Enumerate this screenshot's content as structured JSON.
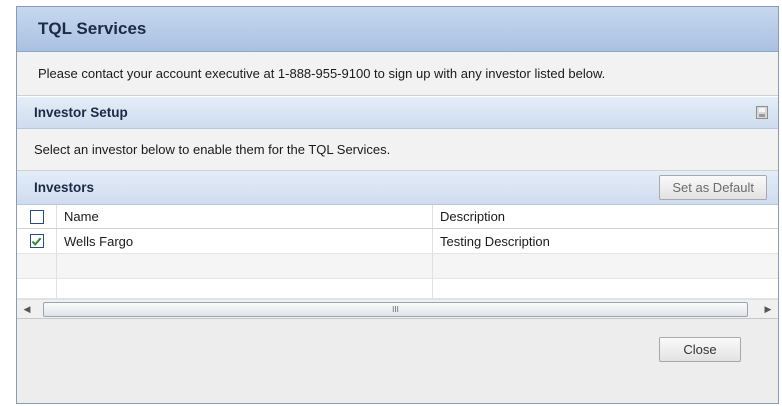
{
  "dialog": {
    "title": "TQL Services",
    "notice": "Please contact your account executive at 1-888-955-9100 to sign up with any investor listed below."
  },
  "investor_setup": {
    "title": "Investor Setup",
    "save_icon": "save-icon",
    "instruction": "Select an investor below to enable them for the TQL Services."
  },
  "investors": {
    "title": "Investors",
    "set_default_label": "Set as Default",
    "columns": [
      "Name",
      "Description"
    ],
    "rows": [
      {
        "checked": true,
        "name": "Wells Fargo",
        "description": "Testing Description"
      }
    ],
    "scroll_grip": "III"
  },
  "footer": {
    "close_label": "Close"
  },
  "colors": {
    "title_bar": "#b7cbe8",
    "section_bar": "#dbe5f3",
    "checkbox_border": "#2b4a8a",
    "checkmark": "#2f8a2f"
  }
}
